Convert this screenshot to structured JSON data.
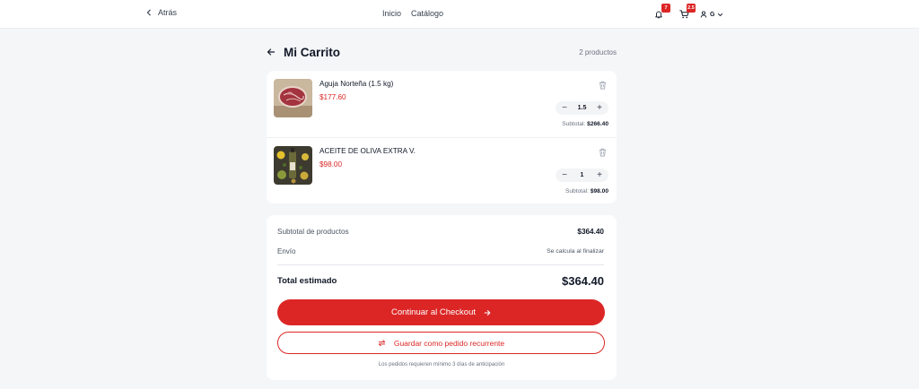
{
  "topbar": {
    "back_label": "Atrás",
    "nav": {
      "home": "Inicio",
      "catalog": "Catálogo"
    },
    "notifications_badge": "7",
    "cart_badge": "2.5",
    "user_initial": "G",
    "icons": [
      "chevron-left-icon",
      "bell-icon",
      "cart-icon",
      "user-icon",
      "chevron-down-icon"
    ]
  },
  "cart": {
    "title": "Mi Carrito",
    "count_text": "2 productos",
    "items": [
      {
        "name": "Aguja Norteña (1.5 kg)",
        "price": "$177.60",
        "qty": "1.5",
        "subtotal_label": "Subtotal:",
        "subtotal_value": "$266.40",
        "image": "beef-steak-photo"
      },
      {
        "name": "ACEITE DE OLIVA EXTRA V.",
        "price": "$98.00",
        "qty": "1",
        "subtotal_label": "Subtotal:",
        "subtotal_value": "$98.00",
        "image": "olive-oil-photo"
      }
    ],
    "minus_symbol": "−",
    "plus_symbol": "+"
  },
  "summary": {
    "products_label": "Subtotal de productos",
    "products_value": "$364.40",
    "shipping_label": "Envío",
    "shipping_value": "Se calcula al finalizar",
    "total_label": "Total estimado",
    "total_value": "$364.40",
    "checkout_label": "Continuar al Checkout",
    "recurring_label": "Guardar como pedido recurrente",
    "note": "Los pedidos requieren mínimo 3 días de anticipación"
  },
  "colors": {
    "accent": "#dc2626",
    "background": "#f5f6f8",
    "card": "#ffffff",
    "text": "#111827",
    "muted": "#6b7280"
  }
}
